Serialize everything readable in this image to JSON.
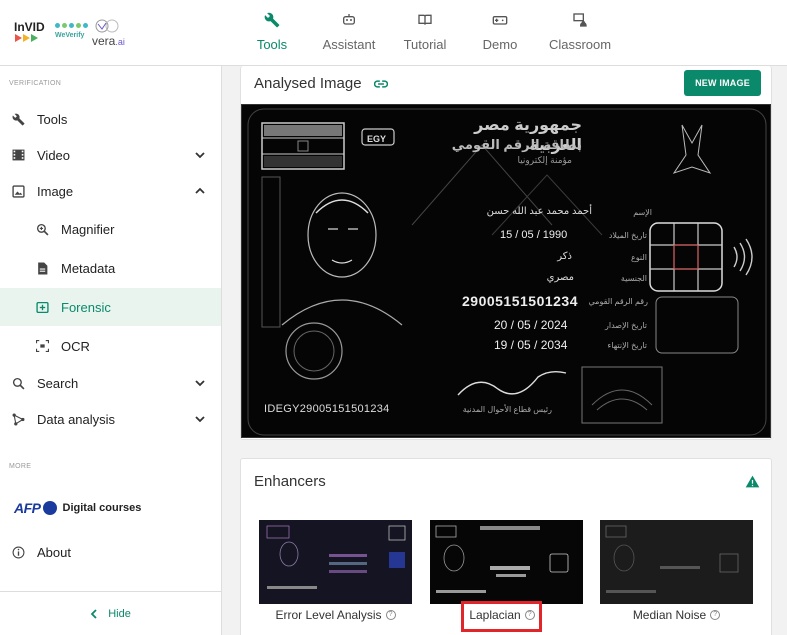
{
  "topbar": {
    "logos": {
      "invid": "InVID",
      "weverify": "WeVerify",
      "vera": "vera",
      "vera_suffix": ".ai"
    },
    "nav": [
      {
        "label": "Tools",
        "icon": "wrench-icon",
        "active": true
      },
      {
        "label": "Assistant",
        "icon": "robot-icon",
        "active": false
      },
      {
        "label": "Tutorial",
        "icon": "book-icon",
        "active": false
      },
      {
        "label": "Demo",
        "icon": "gamepad-icon",
        "active": false
      },
      {
        "label": "Classroom",
        "icon": "classroom-icon",
        "active": false
      }
    ]
  },
  "sidebar": {
    "section_verification": "VERIFICATION",
    "items": [
      {
        "label": "Tools",
        "icon": "wrench-icon"
      },
      {
        "label": "Video",
        "icon": "film-icon",
        "chevron": "down"
      },
      {
        "label": "Image",
        "icon": "image-icon",
        "chevron": "up"
      },
      {
        "label": "Magnifier",
        "icon": "magnifier-icon",
        "sub": true
      },
      {
        "label": "Metadata",
        "icon": "document-icon",
        "sub": true
      },
      {
        "label": "Forensic",
        "icon": "forensic-icon",
        "sub": true,
        "active": true
      },
      {
        "label": "OCR",
        "icon": "ocr-icon",
        "sub": true
      },
      {
        "label": "Search",
        "icon": "search-icon",
        "chevron": "down"
      },
      {
        "label": "Data analysis",
        "icon": "graph-icon",
        "chevron": "down"
      }
    ],
    "section_more": "MORE",
    "afp_logo": "AFP",
    "digital_courses": "Digital courses",
    "about": "About",
    "hide": "Hide"
  },
  "analysed": {
    "title": "Analysed Image",
    "new_image": "NEW IMAGE",
    "id_card": {
      "country_code": "EGY",
      "header_line1": "جمهورية مصر العربية",
      "header_line2": "بطاقة الرقم القومي",
      "header_line3": "مؤمنة إلكترونيا",
      "name_label": "الإسم",
      "name_value": "أحمد محمد عبد الله حسن",
      "birth_label": "تاريخ الميلاد",
      "birth_value": "15 / 05 / 1990",
      "gender_label": "النوع",
      "gender_value": "ذكر",
      "nationality_label": "الجنسية",
      "nationality_value": "مصري",
      "national_id_label": "رقم الرقم القومي",
      "national_id": "29005151501234",
      "issue_label": "تاريخ الإصدار",
      "issue_date": "20 / 05 / 2024",
      "expiry_label": "تاريخ الإنتهاء",
      "expiry_date": "19 / 05 / 2034",
      "mrz": "IDEGY29005151501234",
      "signature_caption": "رئيس قطاع الأحوال المدنية"
    }
  },
  "enhancers": {
    "title": "Enhancers",
    "items": [
      {
        "label": "Error Level Analysis"
      },
      {
        "label": "Laplacian"
      },
      {
        "label": "Median Noise"
      }
    ]
  },
  "colors": {
    "accent": "#0a8a6a",
    "highlight": "#e0262a",
    "warning": "#0a8a6a"
  }
}
